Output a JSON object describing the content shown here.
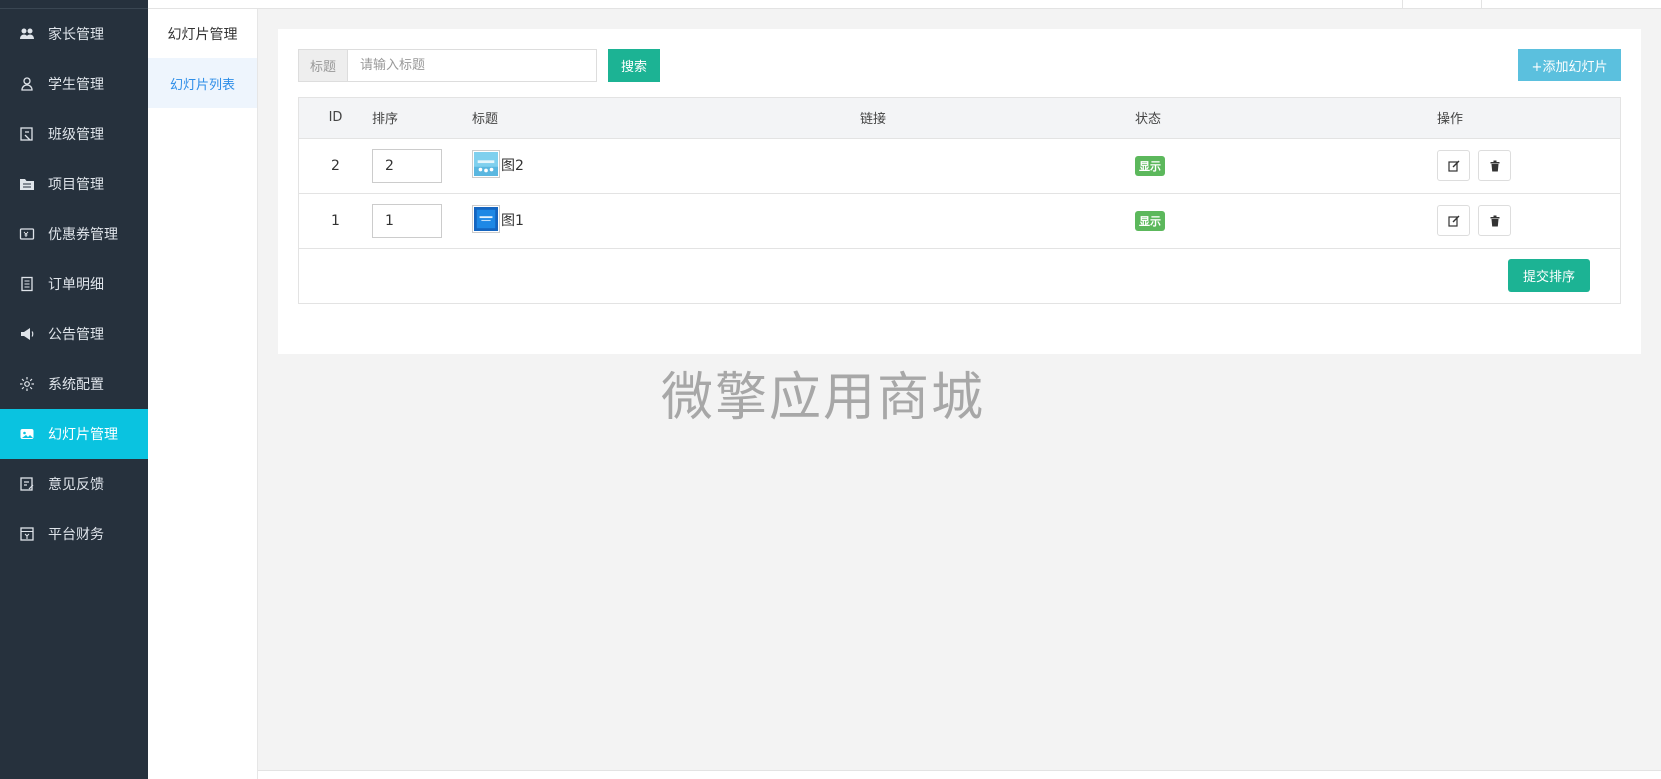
{
  "sidebar": {
    "items": [
      {
        "label": "家长管理",
        "icon": "parents-icon"
      },
      {
        "label": "学生管理",
        "icon": "user-icon"
      },
      {
        "label": "班级管理",
        "icon": "class-icon"
      },
      {
        "label": "项目管理",
        "icon": "folder-icon"
      },
      {
        "label": "优惠券管理",
        "icon": "coupon-icon"
      },
      {
        "label": "订单明细",
        "icon": "order-icon"
      },
      {
        "label": "公告管理",
        "icon": "megaphone-icon"
      },
      {
        "label": "系统配置",
        "icon": "gear-icon"
      },
      {
        "label": "幻灯片管理",
        "icon": "slides-icon",
        "active": true
      },
      {
        "label": "意见反馈",
        "icon": "feedback-icon"
      },
      {
        "label": "平台财务",
        "icon": "finance-icon"
      }
    ]
  },
  "subnav": {
    "title": "幻灯片管理",
    "items": [
      {
        "label": "幻灯片列表",
        "active": true
      }
    ]
  },
  "search": {
    "label": "标题",
    "placeholder": "请输入标题",
    "value": "",
    "button": "搜索"
  },
  "add_button": "+添加幻灯片",
  "table": {
    "headers": [
      "ID",
      "排序",
      "标题",
      "链接",
      "状态",
      "操作"
    ],
    "rows": [
      {
        "id": "2",
        "sort": "2",
        "title": "图2",
        "link": "",
        "status": "显示"
      },
      {
        "id": "1",
        "sort": "1",
        "title": "图1",
        "link": "",
        "status": "显示"
      }
    ]
  },
  "submit_button": "提交排序",
  "watermark": "微擎应用商城",
  "colors": {
    "sidebar_bg": "#26313d",
    "active_nav": "#0ac3e0",
    "primary_green": "#1cb394",
    "info_blue": "#5bc0de",
    "status_green": "#5cb85c"
  }
}
